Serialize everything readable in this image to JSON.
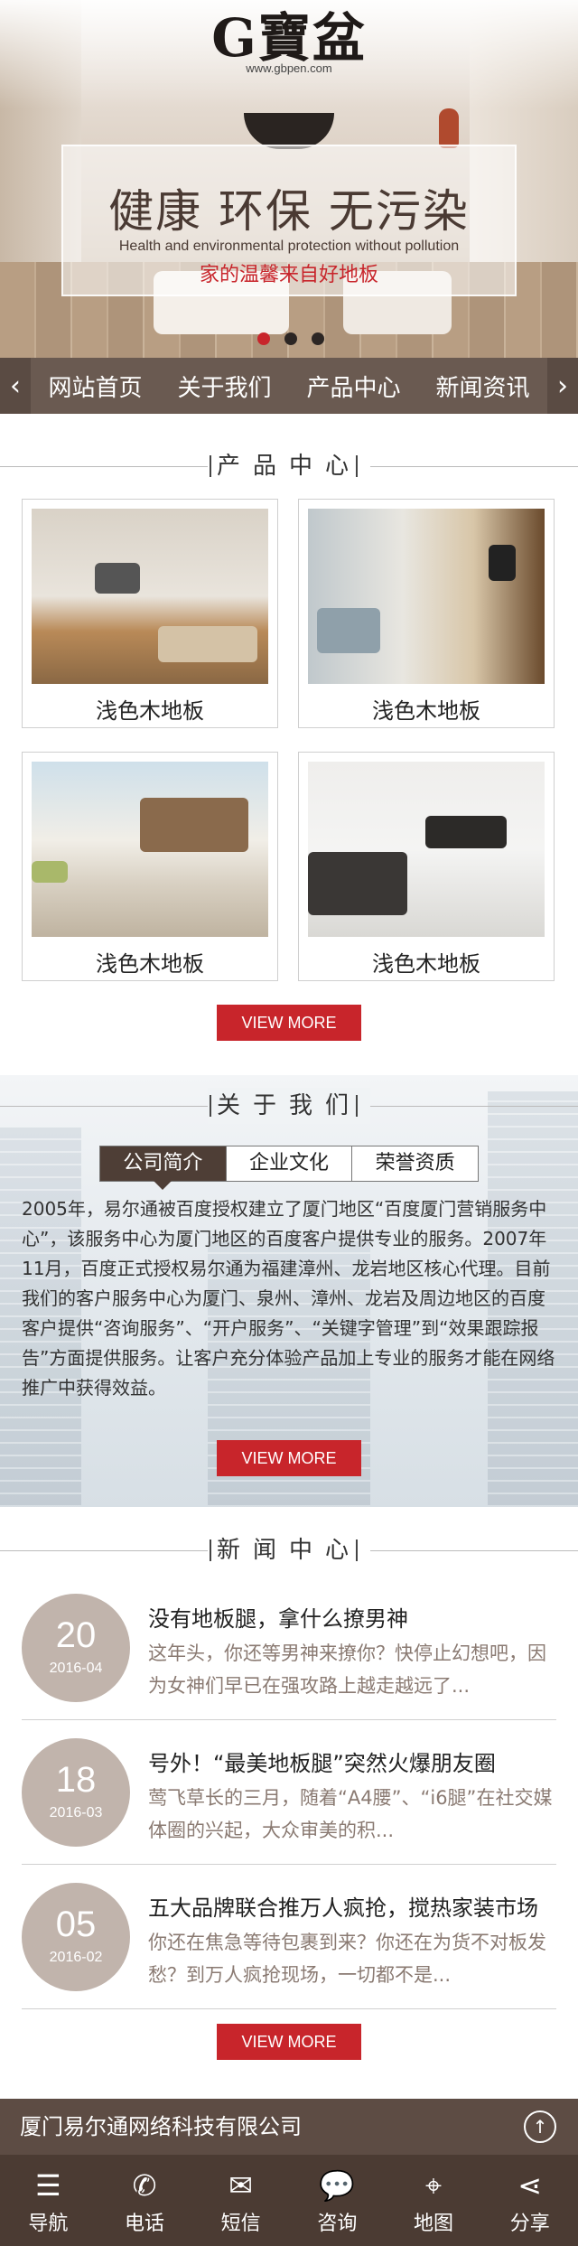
{
  "brand": {
    "logo_mark": "G寶盆",
    "url": "www.gbpen.com"
  },
  "hero": {
    "headline": "健康  环保  无污染",
    "subline": "Health and environmental protection without pollution",
    "tagline": "家的温馨来自好地板",
    "slide_count": 3,
    "active_slide": 1
  },
  "nav": {
    "prev_icon": "chevron-left-icon",
    "next_icon": "chevron-right-icon",
    "items": [
      "网站首页",
      "关于我们",
      "产品中心",
      "新闻资讯"
    ]
  },
  "products": {
    "title": "产品中心",
    "items": [
      {
        "caption": "浅色木地板"
      },
      {
        "caption": "浅色木地板"
      },
      {
        "caption": "浅色木地板"
      },
      {
        "caption": "浅色木地板"
      }
    ],
    "more_label": "VIEW MORE"
  },
  "about": {
    "title": "关于我们",
    "tabs": [
      "公司简介",
      "企业文化",
      "荣誉资质"
    ],
    "active_tab": 0,
    "text": "2005年，易尔通被百度授权建立了厦门地区“百度厦门营销服务中心”，该服务中心为厦门地区的百度客户提供专业的服务。2007年11月，百度正式授权易尔通为福建漳州、龙岩地区核心代理。目前我们的客户服务中心为厦门、泉州、漳州、龙岩及周边地区的百度客户提供“咨询服务”、“开户服务”、“关键字管理”到“效果跟踪报告”方面提供服务。让客户充分体验产品加上专业的服务才能在网络推广中获得效益。",
    "more_label": "VIEW MORE"
  },
  "news": {
    "title": "新闻中心",
    "items": [
      {
        "day": "20",
        "ym": "2016-04",
        "title": "没有地板腿，拿什么撩男神",
        "summary": "这年头，你还等男神来撩你？快停止幻想吧，因为女神们早已在强攻路上越走越远了..."
      },
      {
        "day": "18",
        "ym": "2016-03",
        "title": "号外！“最美地板腿”突然火爆朋友圈",
        "summary": "莺飞草长的三月，随着“A4腰”、“i6腿”在社交媒体圈的兴起，大众审美的积..."
      },
      {
        "day": "05",
        "ym": "2016-02",
        "title": "五大品牌联合推万人疯抢，搅热家装市场",
        "summary": "你还在焦急等待包裹到来？你还在为货不对板发愁？到万人疯抢现场，一切都不是..."
      }
    ],
    "more_label": "VIEW MORE"
  },
  "footer": {
    "company": "厦门易尔通网络科技有限公司",
    "top_icon": "arrow-up-icon",
    "tabs": [
      {
        "label": "导航",
        "icon": "menu-icon"
      },
      {
        "label": "电话",
        "icon": "phone-icon"
      },
      {
        "label": "短信",
        "icon": "envelope-icon"
      },
      {
        "label": "咨询",
        "icon": "chat-icon"
      },
      {
        "label": "地图",
        "icon": "map-pin-icon"
      },
      {
        "label": "分享",
        "icon": "share-icon"
      }
    ]
  },
  "colors": {
    "accent": "#c8252b",
    "brown": "#5d4c44",
    "dark_brown": "#4b3b33"
  }
}
